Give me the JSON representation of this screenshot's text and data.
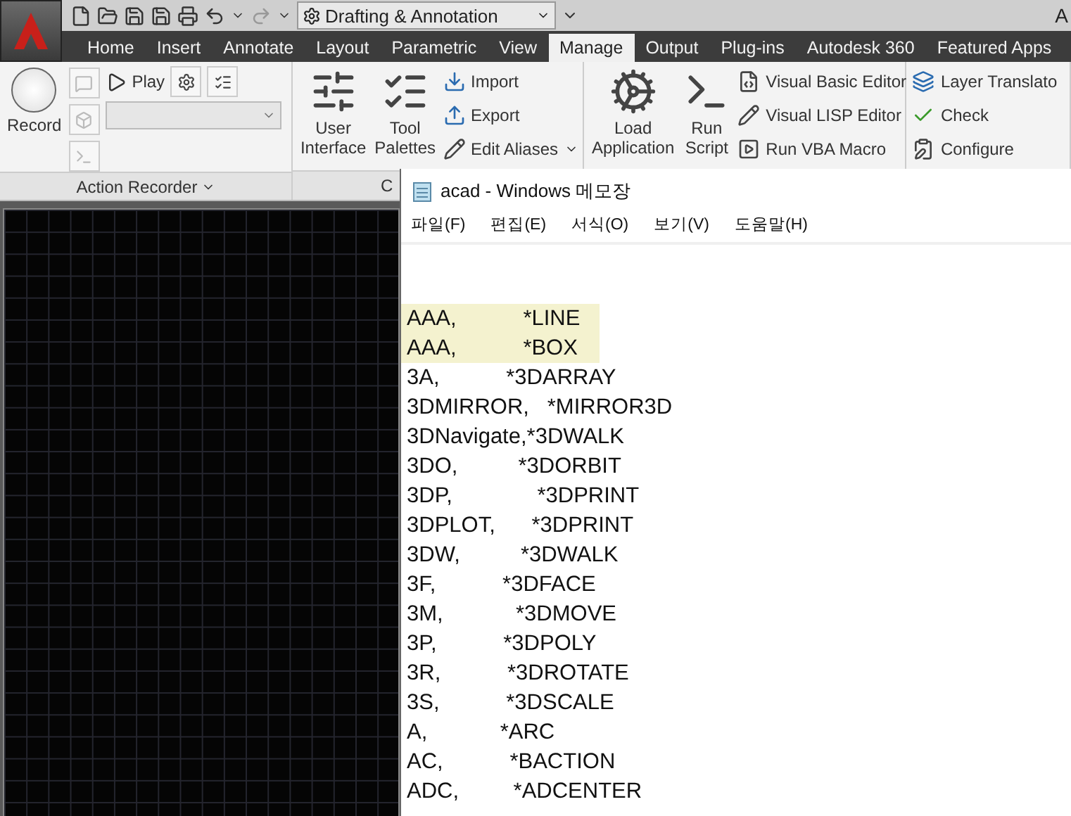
{
  "app_title": "A",
  "quick_access": {
    "workspace": "Drafting & Annotation"
  },
  "tabs": [
    {
      "label": "Home",
      "selected": false
    },
    {
      "label": "Insert",
      "selected": false
    },
    {
      "label": "Annotate",
      "selected": false
    },
    {
      "label": "Layout",
      "selected": false
    },
    {
      "label": "Parametric",
      "selected": false
    },
    {
      "label": "View",
      "selected": false
    },
    {
      "label": "Manage",
      "selected": true
    },
    {
      "label": "Output",
      "selected": false
    },
    {
      "label": "Plug-ins",
      "selected": false
    },
    {
      "label": "Autodesk 360",
      "selected": false
    },
    {
      "label": "Featured Apps",
      "selected": false
    }
  ],
  "ribbon": {
    "panels": [
      {
        "kind": "recorder",
        "title": "Action Recorder",
        "record_label": "Record",
        "play_label": "Play",
        "small_buttons": [
          {
            "disabled": true
          },
          {
            "disabled": true
          },
          {
            "disabled": true
          }
        ]
      },
      {
        "kind": "tools",
        "title": "C",
        "large_buttons": [
          {
            "label": "User\nInterface"
          },
          {
            "label": "Tool\nPalettes"
          }
        ],
        "small_buttons": [
          {
            "label": "Import",
            "dropdown": false
          },
          {
            "label": "Export",
            "dropdown": false
          },
          {
            "label": "Edit Aliases",
            "dropdown": true
          }
        ]
      },
      {
        "kind": "tools",
        "large_buttons": [
          {
            "label": "Load\nApplication"
          },
          {
            "label": "Run\nScript"
          }
        ],
        "small_buttons": [
          {
            "label": "Visual Basic Editor",
            "dropdown": false
          },
          {
            "label": "Visual LISP Editor",
            "dropdown": false
          },
          {
            "label": "Run VBA Macro",
            "dropdown": false
          }
        ]
      },
      {
        "kind": "tools",
        "small_buttons": [
          {
            "label": "Layer Translato",
            "dropdown": false
          },
          {
            "label": "Check",
            "dropdown": false
          },
          {
            "label": "Configure",
            "dropdown": false
          }
        ]
      }
    ]
  },
  "notepad": {
    "title": "acad - Windows 메모장",
    "menu": [
      "파일(F)",
      "편집(E)",
      "서식(O)",
      "보기(V)",
      "도움말(H)"
    ],
    "lines": [
      {
        "text": "AAA,           *LINE",
        "highlighted": true
      },
      {
        "text": "AAA,           *BOX",
        "highlighted": true
      },
      {
        "text": "3A,           *3DARRAY",
        "highlighted": false
      },
      {
        "text": "3DMIRROR,   *MIRROR3D",
        "highlighted": false
      },
      {
        "text": "3DNavigate,*3DWALK",
        "highlighted": false
      },
      {
        "text": "3DO,          *3DORBIT",
        "highlighted": false
      },
      {
        "text": "3DP,              *3DPRINT",
        "highlighted": false
      },
      {
        "text": "3DPLOT,      *3DPRINT",
        "highlighted": false
      },
      {
        "text": "3DW,          *3DWALK",
        "highlighted": false
      },
      {
        "text": "3F,           *3DFACE",
        "highlighted": false
      },
      {
        "text": "3M,            *3DMOVE",
        "highlighted": false
      },
      {
        "text": "3P,           *3DPOLY",
        "highlighted": false
      },
      {
        "text": "3R,           *3DROTATE",
        "highlighted": false
      },
      {
        "text": "3S,           *3DSCALE",
        "highlighted": false
      },
      {
        "text": "A,            *ARC",
        "highlighted": false
      },
      {
        "text": "AC,           *BACTION",
        "highlighted": false
      },
      {
        "text": "ADC,         *ADCENTER",
        "highlighted": false
      }
    ]
  }
}
